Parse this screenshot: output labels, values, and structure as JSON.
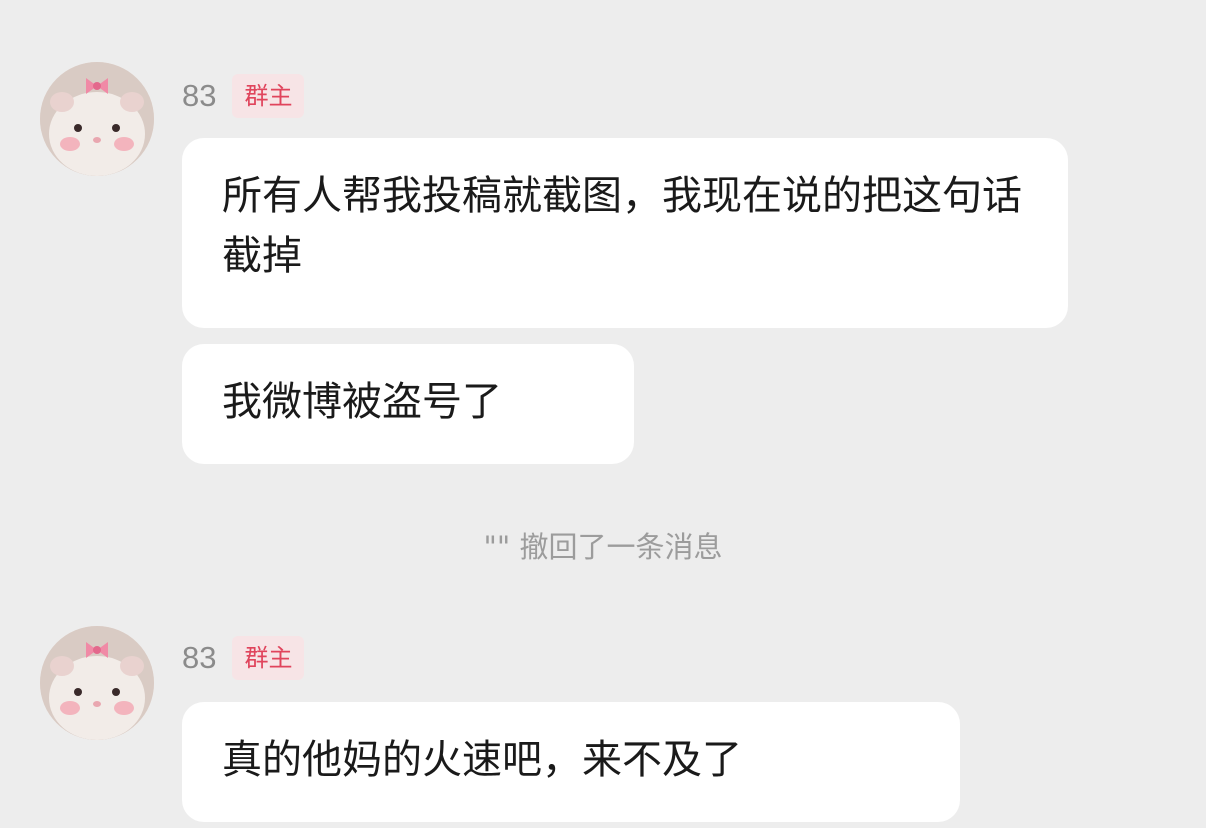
{
  "messages": [
    {
      "sender": "83",
      "role_badge": "群主",
      "bubbles": [
        "所有人帮我投稿就截图，我现在说的把这句话截掉",
        "我微博被盗号了"
      ]
    },
    {
      "sender": "83",
      "role_badge": "群主",
      "bubbles": [
        "真的他妈的火速吧，来不及了"
      ]
    }
  ],
  "recall_notice": "\"\" 撤回了一条消息",
  "colors": {
    "background": "#ededed",
    "bubble": "#ffffff",
    "badge_bg": "#f7e4e6",
    "badge_text": "#e0445c",
    "meta_text": "#8b8b8b"
  },
  "avatar_icon": "hamster-with-pink-bow-icon"
}
